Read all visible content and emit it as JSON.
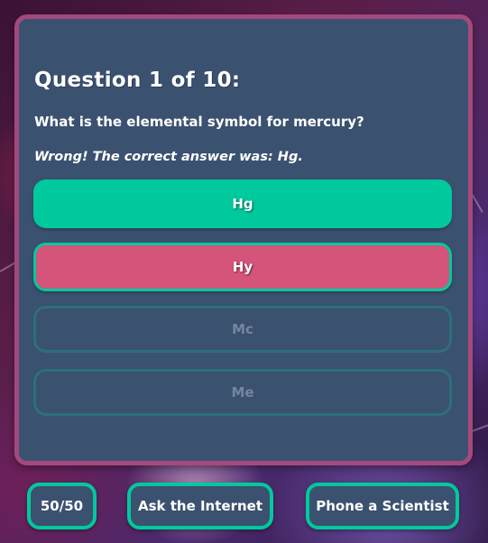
{
  "quiz": {
    "question_heading": "Question 1 of 10:",
    "question_text": "What is the elemental symbol for mercury?",
    "feedback": "Wrong! The correct answer was: Hg.",
    "answers": [
      {
        "label": "Hg",
        "state": "correct"
      },
      {
        "label": "Hy",
        "state": "selected-wrong"
      },
      {
        "label": "Mc",
        "state": "disabled"
      },
      {
        "label": "Me",
        "state": "disabled"
      }
    ]
  },
  "lifelines": {
    "fifty_fifty": "50/50",
    "ask_internet": "Ask the Internet",
    "phone_scientist": "Phone a Scientist"
  },
  "colors": {
    "card_background": "#3b5170",
    "card_border": "#a5497d",
    "correct_green": "#00c99e",
    "wrong_pink": "#d4547a",
    "disabled_border": "#2d7079"
  }
}
